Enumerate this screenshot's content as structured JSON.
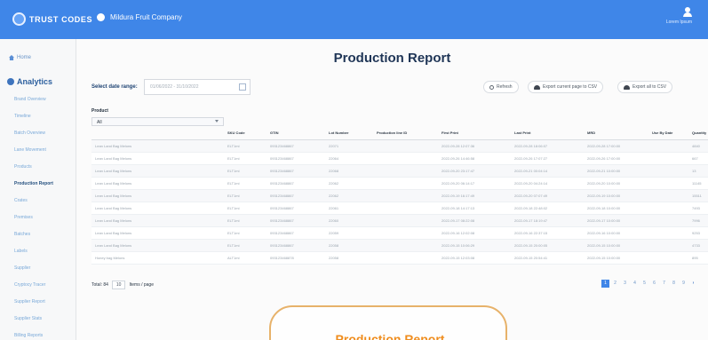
{
  "topbar": {
    "brand": "TRUST CODES",
    "company": "Mildura Fruit Company",
    "user_label": "Lorem Ipsum"
  },
  "sidebar": {
    "home": "Home",
    "analytics": "Analytics",
    "items": [
      "Brand Overview",
      "Timeline",
      "Batch Overview",
      "Lane Movement",
      "Products",
      "Production Report",
      "Crates",
      "Premises",
      "Batches",
      "Labels",
      "Supplier",
      "Cryptocy Tracer",
      "Supplier Report",
      "Supplier Stats",
      "Billing Reports"
    ]
  },
  "main": {
    "title": "Production Report",
    "date_label": "Select date range:",
    "date_value": "01/06/2022 - 31/10/2022",
    "refresh": "Refresh",
    "export_page": "Export current page to CSV",
    "export_all": "Export all to CSV",
    "product_filter_label": "Product",
    "product_filter_value": "All"
  },
  "table": {
    "headers": [
      "",
      "SKU Code",
      "GTIN",
      "Lot Number",
      "Production line ID",
      "First Print",
      "Last Print",
      "MRD",
      "Use By Date",
      "Quantity"
    ],
    "rows": [
      [
        "Lean Land Bag Melons",
        "ELT1mi",
        "093123468867",
        "22071",
        "",
        "2022-09-28 12:07:36",
        "2022-09-28 18:06:07",
        "2022-09-28 17:00:00",
        "",
        "4840"
      ],
      [
        "Lean Land Bag Melons",
        "ELT1mi",
        "093123468867",
        "22064",
        "",
        "2022-09-26 14:46:58",
        "2022-09-26 17:07:27",
        "2022-09-26 17:00:00",
        "",
        "667"
      ],
      [
        "Lean Land Bag Melons",
        "ELT1mi",
        "093123468867",
        "22068",
        "",
        "2022-09-20 23:17:47",
        "2022-09-21 00:04:14",
        "2022-09-21 10:00:00",
        "",
        "13"
      ],
      [
        "Lean Land Bag Melons",
        "ELT1mi",
        "093123468867",
        "22062",
        "",
        "2022-09-20 06:14:17",
        "2022-09-20 04:24:14",
        "2022-09-20 10:00:00",
        "",
        "11145"
      ],
      [
        "Lean Land Bag Melons",
        "ELT1mi",
        "093123468867",
        "22062",
        "",
        "2022-09-19 16:17:49",
        "2022-09-20 07:07:49",
        "2022-09-19 10:00:00",
        "",
        "15511"
      ],
      [
        "Lean Land Bag Melons",
        "ELT1mi",
        "093123468867",
        "22061",
        "",
        "2022-09-18 14:17:13",
        "2022-09-18 22:48:02",
        "2022-09-18 10:00:00",
        "",
        "7493"
      ],
      [
        "Lean Land Bag Melons",
        "ELT1mi",
        "093123468867",
        "22060",
        "",
        "2022-09-17 08:22:08",
        "2022-09-17 18:19:47",
        "2022-09-17 10:00:00",
        "",
        "7996"
      ],
      [
        "Lean Land Bag Melons",
        "ELT1mi",
        "093123468867",
        "22059",
        "",
        "2022-09-16 12:02:08",
        "2022-09-16 22:37:15",
        "2022-09-16 10:00:00",
        "",
        "9253"
      ],
      [
        "Lean Land Bag Melons",
        "ELT1mi",
        "093123468867",
        "22058",
        "",
        "2022-09-15 10:06:29",
        "2022-09-15 20:00:05",
        "2022-09-15 10:00:00",
        "",
        "4733"
      ],
      [
        "Honey bag Melons",
        "ALT1mi",
        "093123468878",
        "22058",
        "",
        "2022-09-15 12:03:08",
        "2022-09-15 20:54:41",
        "2022-09-15 10:00:00",
        "",
        "895"
      ]
    ]
  },
  "footer": {
    "total": "Total: 84",
    "per_page_value": "10",
    "per_page_label": "Items / page",
    "pages": [
      "1",
      "2",
      "3",
      "4",
      "5",
      "6",
      "7",
      "8",
      "9"
    ]
  },
  "callout": {
    "text": "Production Report"
  }
}
